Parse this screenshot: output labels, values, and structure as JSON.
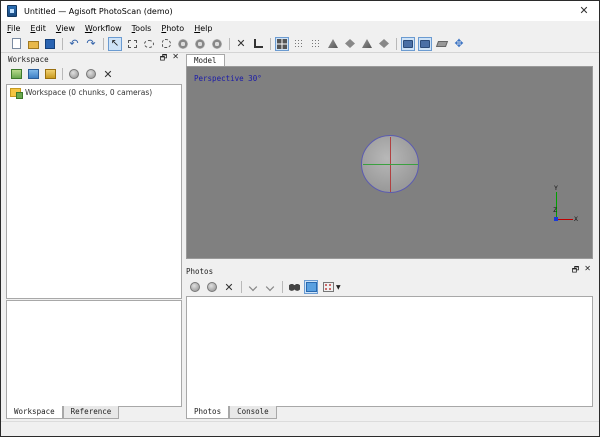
{
  "window": {
    "title": "Untitled — Agisoft PhotoScan (demo)",
    "close_glyph": "✕"
  },
  "menu": [
    "File",
    "Edit",
    "View",
    "Workflow",
    "Tools",
    "Photo",
    "Help"
  ],
  "toolbar": {
    "icons": [
      "new-document-icon",
      "open-folder-icon",
      "save-icon",
      "undo-icon",
      "redo-icon",
      "navigation-cursor-icon",
      "rectangle-selection-icon",
      "circle-selection-icon",
      "free-form-selection-icon",
      "rotate-object-icon",
      "rotate-region-icon",
      "resize-region-icon",
      "delete-selection-icon",
      "crop-selection-icon",
      "show-cameras-grid-icon",
      "point-cloud-icon",
      "dense-cloud-icon",
      "shaded-model-icon",
      "solid-model-icon",
      "wireframe-model-icon",
      "textured-model-icon",
      "show-cameras-icon",
      "show-region-icon",
      "ground-plane-icon",
      "move-view-icon"
    ]
  },
  "workspace": {
    "title": "Workspace",
    "tree_root": "Workspace (0 chunks, 0 cameras)",
    "tabs": [
      "Workspace",
      "Reference"
    ]
  },
  "model": {
    "tab": "Model",
    "projection_label": "Perspective 30°",
    "axis_labels": {
      "x": "X",
      "y": "Y",
      "z": "Z"
    }
  },
  "photos": {
    "title": "Photos",
    "tabs": [
      "Photos",
      "Console"
    ]
  },
  "pane_controls": {
    "float": "🗗",
    "close": "✕"
  },
  "colors": {
    "viewport_bg": "#808080",
    "projection_label": "#1a1aa8",
    "axis_x": "#c00000",
    "axis_y": "#00a000",
    "axis_z": "#1a3ad8"
  }
}
